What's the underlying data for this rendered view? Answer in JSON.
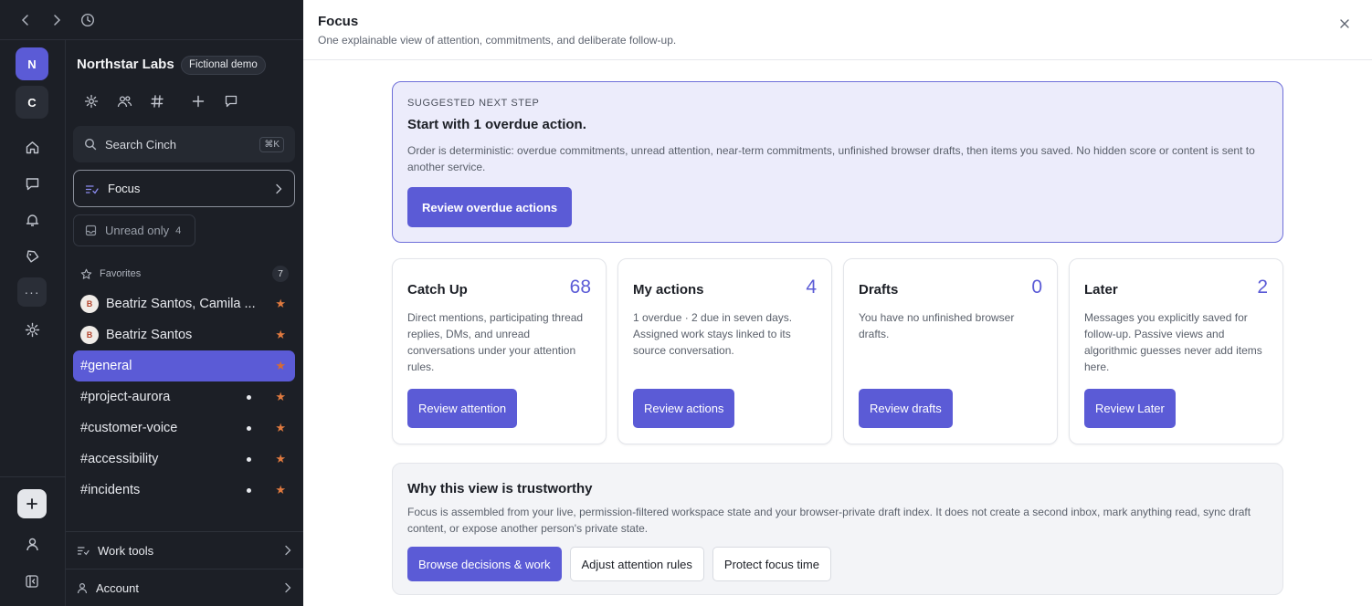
{
  "sidebar": {
    "org_name": "Northstar Labs",
    "org_badge": "Fictional demo",
    "workspaces": [
      {
        "initial": "N"
      },
      {
        "initial": "C"
      }
    ],
    "more_label": "···",
    "search": {
      "label": "Search Cinch",
      "shortcut": "⌘K"
    },
    "focus": {
      "label": "Focus"
    },
    "unread": {
      "label": "Unread only",
      "count": "4"
    },
    "favorites": {
      "label": "Favorites",
      "count": "7"
    },
    "channels": [
      {
        "name": "Beatriz Santos, Camila ...",
        "avatar": "B",
        "unread": false,
        "active": false
      },
      {
        "name": "Beatriz Santos",
        "avatar": "B",
        "unread": false,
        "active": false
      },
      {
        "name": "#general",
        "unread": false,
        "active": true
      },
      {
        "name": "#project-aurora",
        "unread": true,
        "active": false
      },
      {
        "name": "#customer-voice",
        "unread": true,
        "active": false
      },
      {
        "name": "#accessibility",
        "unread": true,
        "active": false
      },
      {
        "name": "#incidents",
        "unread": true,
        "active": false
      }
    ],
    "work_tools": "Work tools",
    "account": "Account"
  },
  "main": {
    "title": "Focus",
    "subtitle": "One explainable view of attention, commitments, and deliberate follow-up.",
    "suggestion": {
      "eyebrow": "SUGGESTED NEXT STEP",
      "heading": "Start with 1 overdue action.",
      "body": "Order is deterministic: overdue commitments, unread attention, near-term commitments, unfinished browser drafts, then items you saved. No hidden score or content is sent to another service.",
      "button": "Review overdue actions"
    },
    "cards": [
      {
        "title": "Catch Up",
        "count": "68",
        "body": "Direct mentions, participating thread replies, DMs, and unread conversations under your attention rules.",
        "button": "Review attention"
      },
      {
        "title": "My actions",
        "count": "4",
        "body": "1 overdue · 2 due in seven days. Assigned work stays linked to its source conversation.",
        "button": "Review actions"
      },
      {
        "title": "Drafts",
        "count": "0",
        "body": "You have no unfinished browser drafts.",
        "button": "Review drafts"
      },
      {
        "title": "Later",
        "count": "2",
        "body": "Messages you explicitly saved for follow-up. Passive views and algorithmic guesses never add items here.",
        "button": "Review Later"
      }
    ],
    "trust": {
      "heading": "Why this view is trustworthy",
      "body": "Focus is assembled from your live, permission-filtered workspace state and your browser-private draft index. It does not create a second inbox, mark anything read, sync draft content, or expose another person's private state.",
      "buttons": [
        "Browse decisions & work",
        "Adjust attention rules",
        "Protect focus time"
      ]
    }
  },
  "colors": {
    "accent": "#5b5bd6",
    "sidebar_bg": "#1c1f26",
    "star": "#e07a3f",
    "suggest_bg": "#ececfb"
  }
}
